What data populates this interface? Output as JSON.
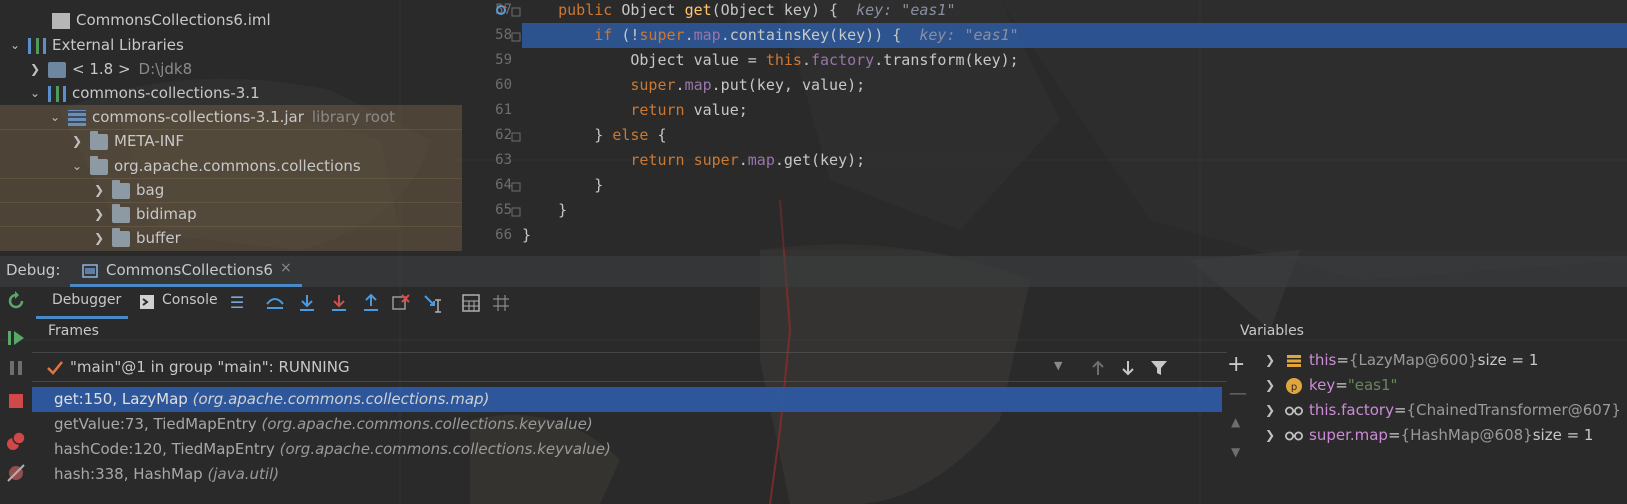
{
  "project_tree": {
    "items": [
      {
        "label": "CommonsCollections6.iml",
        "muted": ""
      },
      {
        "label": "External Libraries",
        "muted": ""
      },
      {
        "label": "< 1.8 >",
        "muted": "D:\\jdk8"
      },
      {
        "label": "commons-collections-3.1",
        "muted": ""
      },
      {
        "label": "commons-collections-3.1.jar",
        "muted": "library root"
      },
      {
        "label": "META-INF",
        "muted": ""
      },
      {
        "label": "org.apache.commons.collections",
        "muted": ""
      },
      {
        "label": "bag",
        "muted": ""
      },
      {
        "label": "bidimap",
        "muted": ""
      },
      {
        "label": "buffer",
        "muted": ""
      }
    ]
  },
  "editor": {
    "line_numbers": [
      "57",
      "58",
      "59",
      "60",
      "61",
      "62",
      "63",
      "64",
      "65",
      "66"
    ],
    "hint_key_57": "key: \"eas1\"",
    "hint_key_58": "key: \"eas1\"",
    "tokens": {
      "public": "public",
      "Object": "Object",
      "get": "get",
      "param": "(Object key) {",
      "if": "if",
      "super": "super",
      "map": "map",
      "containsKey": ".containsKey(key)) {",
      "value_decl": "Object value = ",
      "this": "this",
      "factory": "factory",
      "transform": ".transform(key);",
      "put": ".put(key, value);",
      "return": "return",
      "value_ret": " value;",
      "else_close": "} ",
      "else": "else",
      "else_open": " {",
      "get_call": ".get(key);",
      "brace": "}"
    }
  },
  "debug": {
    "label": "Debug:",
    "session_tab": "CommonsCollections6",
    "tabs": {
      "debugger": "Debugger",
      "console": "Console"
    },
    "frames_title": "Frames",
    "thread": "\"main\"@1 in group \"main\": RUNNING",
    "frames": [
      {
        "method": "get:150, LazyMap",
        "pkg": "(org.apache.commons.collections.map)"
      },
      {
        "method": "getValue:73, TiedMapEntry",
        "pkg": "(org.apache.commons.collections.keyvalue)"
      },
      {
        "method": "hashCode:120, TiedMapEntry",
        "pkg": "(org.apache.commons.collections.keyvalue)"
      },
      {
        "method": "hash:338, HashMap",
        "pkg": "(java.util)"
      }
    ],
    "variables_title": "Variables",
    "variables": [
      {
        "name": "this",
        "eq": " = ",
        "value": "{LazyMap@600}",
        "extra": " size = 1",
        "icon": "field-stack-icon"
      },
      {
        "name": "key",
        "eq": " = ",
        "value": "\"eas1\"",
        "extra": "",
        "icon": "parameter-icon"
      },
      {
        "name": "this.factory",
        "eq": " = ",
        "value": "{ChainedTransformer@607}",
        "extra": "",
        "icon": "watch-glasses-icon"
      },
      {
        "name": "super.map",
        "eq": " = ",
        "value": "{HashMap@608}",
        "extra": " size = 1",
        "icon": "watch-glasses-icon"
      }
    ]
  }
}
